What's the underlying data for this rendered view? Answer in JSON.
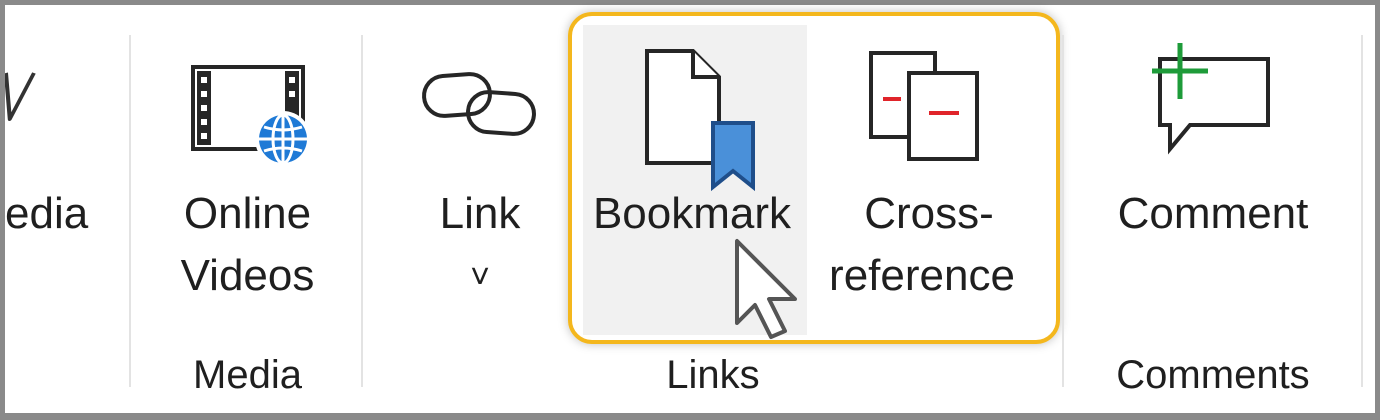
{
  "ribbon": {
    "partial_media_label": "edia",
    "media_group": {
      "label": "Media",
      "online_videos": {
        "line1": "Online",
        "line2": "Videos",
        "icon": "online-video-icon"
      }
    },
    "links_group": {
      "label": "Links",
      "link": {
        "label": "Link",
        "chevron": "˅",
        "icon": "link-icon"
      },
      "bookmark": {
        "label": "Bookmark",
        "icon": "bookmark-icon"
      },
      "cross_reference": {
        "line1": "Cross-",
        "line2": "reference",
        "icon": "cross-reference-icon"
      }
    },
    "comments_group": {
      "label": "Comments",
      "comment": {
        "label": "Comment",
        "icon": "new-comment-icon"
      }
    }
  },
  "colors": {
    "highlight": "#f4b71d",
    "bookmark_ribbon": "#4a90d9",
    "globe": "#1f7ad6",
    "cross_ref_red": "#e0242a",
    "comment_plus": "#1e9b39"
  }
}
